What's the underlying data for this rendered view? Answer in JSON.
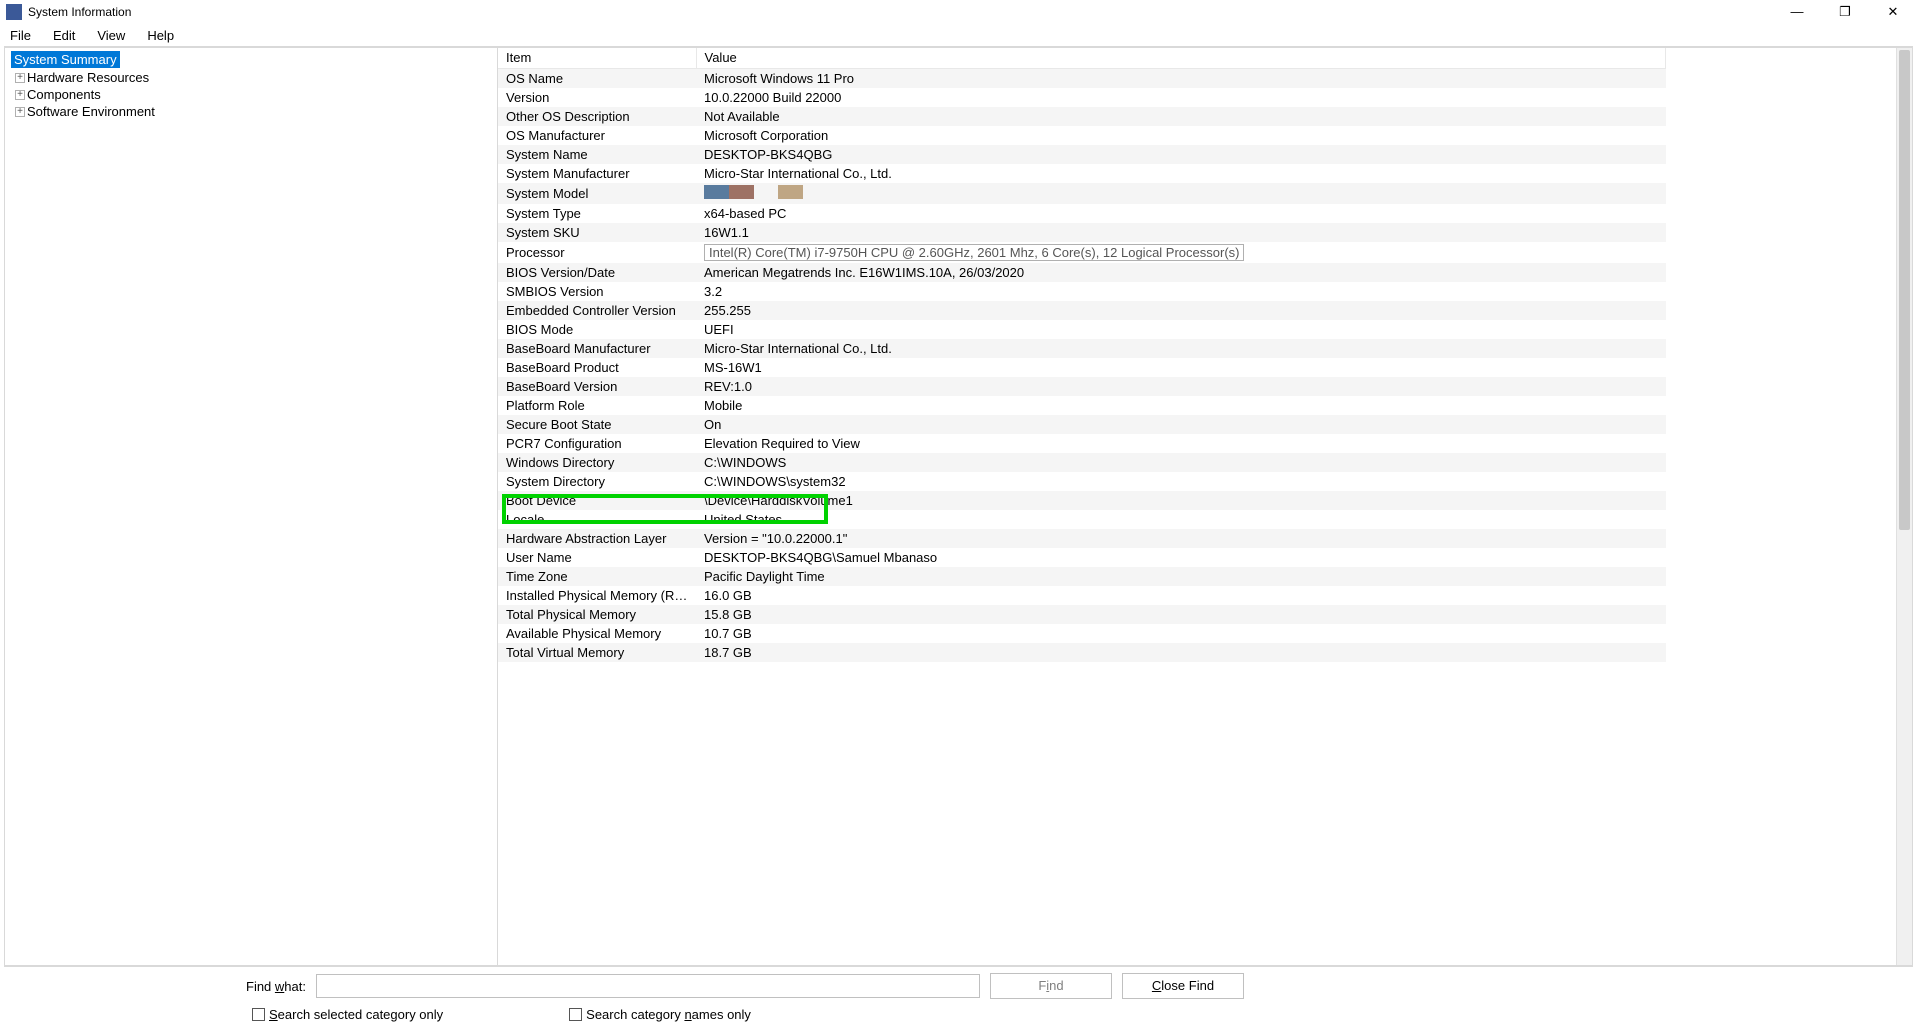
{
  "window": {
    "title": "System Information",
    "minimize_glyph": "—",
    "maximize_glyph": "❐",
    "close_glyph": "✕"
  },
  "menu": {
    "file": "File",
    "edit": "Edit",
    "view": "View",
    "help": "Help"
  },
  "tree": {
    "root": "System Summary",
    "items": [
      "Hardware Resources",
      "Components",
      "Software Environment"
    ]
  },
  "columns": {
    "item": "Item",
    "value": "Value"
  },
  "rows": [
    {
      "item": "OS Name",
      "value": "Microsoft Windows 11 Pro"
    },
    {
      "item": "Version",
      "value": "10.0.22000 Build 22000"
    },
    {
      "item": "Other OS Description",
      "value": "Not Available"
    },
    {
      "item": "OS Manufacturer",
      "value": "Microsoft Corporation"
    },
    {
      "item": "System Name",
      "value": "DESKTOP-BKS4QBG"
    },
    {
      "item": "System Manufacturer",
      "value": "Micro-Star International Co., Ltd."
    },
    {
      "item": "System Model",
      "value": ""
    },
    {
      "item": "System Type",
      "value": "x64-based PC"
    },
    {
      "item": "System SKU",
      "value": "16W1.1"
    },
    {
      "item": "Processor",
      "value": "Intel(R) Core(TM) i7-9750H CPU @ 2.60GHz, 2601 Mhz, 6 Core(s), 12 Logical Processor(s)"
    },
    {
      "item": "BIOS Version/Date",
      "value": "American Megatrends Inc. E16W1IMS.10A, 26/03/2020"
    },
    {
      "item": "SMBIOS Version",
      "value": "3.2"
    },
    {
      "item": "Embedded Controller Version",
      "value": "255.255"
    },
    {
      "item": "BIOS Mode",
      "value": "UEFI"
    },
    {
      "item": "BaseBoard Manufacturer",
      "value": "Micro-Star International Co., Ltd."
    },
    {
      "item": "BaseBoard Product",
      "value": "MS-16W1"
    },
    {
      "item": "BaseBoard Version",
      "value": "REV:1.0"
    },
    {
      "item": "Platform Role",
      "value": "Mobile"
    },
    {
      "item": "Secure Boot State",
      "value": "On"
    },
    {
      "item": "PCR7 Configuration",
      "value": "Elevation Required to View"
    },
    {
      "item": "Windows Directory",
      "value": "C:\\WINDOWS"
    },
    {
      "item": "System Directory",
      "value": "C:\\WINDOWS\\system32"
    },
    {
      "item": "Boot Device",
      "value": "\\Device\\HarddiskVolume1"
    },
    {
      "item": "Locale",
      "value": "United States"
    },
    {
      "item": "Hardware Abstraction Layer",
      "value": "Version = \"10.0.22000.1\""
    },
    {
      "item": "User Name",
      "value": "DESKTOP-BKS4QBG\\Samuel Mbanaso"
    },
    {
      "item": "Time Zone",
      "value": "Pacific Daylight Time"
    },
    {
      "item": "Installed Physical Memory (RA...",
      "value": "16.0 GB"
    },
    {
      "item": "Total Physical Memory",
      "value": "15.8 GB"
    },
    {
      "item": "Available Physical Memory",
      "value": "10.7 GB"
    },
    {
      "item": "Total Virtual Memory",
      "value": "18.7 GB"
    }
  ],
  "find": {
    "label_prefix": "Find ",
    "label_under": "w",
    "label_suffix": "hat:",
    "find_under": "i",
    "find_suffix": "nd",
    "close_under": "C",
    "close_suffix": "lose Find",
    "cb1_under": "S",
    "cb1_suffix": "earch selected category only",
    "cb2_prefix": "Search category ",
    "cb2_under": "n",
    "cb2_suffix": "ames only"
  },
  "highlight": {
    "row_index": 18
  }
}
